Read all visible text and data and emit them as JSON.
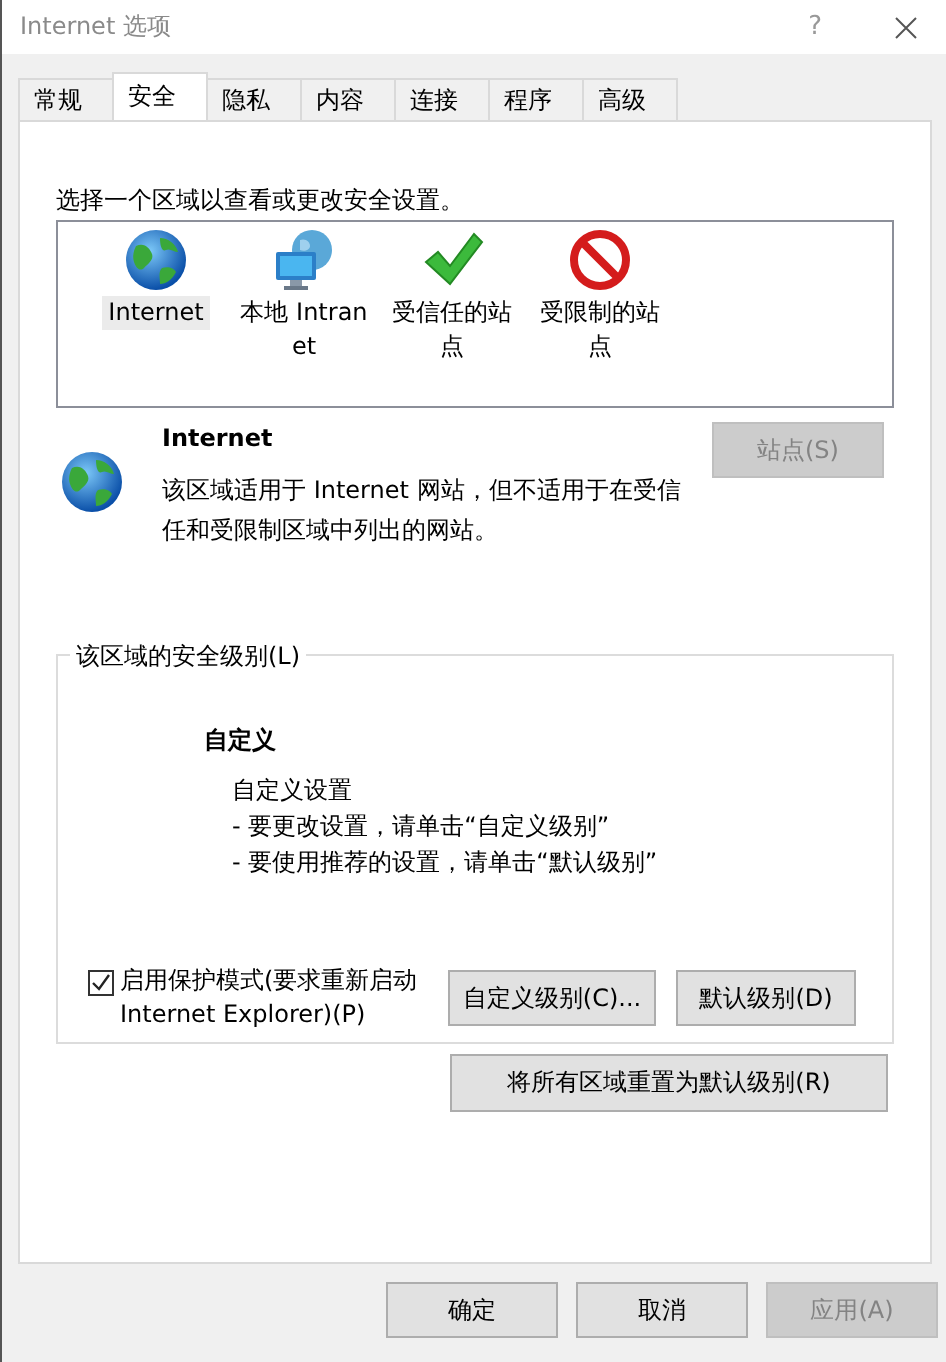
{
  "window": {
    "title": "Internet 选项",
    "help": "?"
  },
  "tabs": [
    {
      "label": "常规",
      "selected": false
    },
    {
      "label": "安全",
      "selected": true
    },
    {
      "label": "隐私",
      "selected": false
    },
    {
      "label": "内容",
      "selected": false
    },
    {
      "label": "连接",
      "selected": false
    },
    {
      "label": "程序",
      "selected": false
    },
    {
      "label": "高级",
      "selected": false
    }
  ],
  "zone_prompt": "选择一个区域以查看或更改安全设置。",
  "zones": [
    {
      "kind": "globe",
      "label": "Internet",
      "selected": true
    },
    {
      "kind": "intranet",
      "label": "本地 Intranet",
      "selected": false
    },
    {
      "kind": "trusted",
      "label": "受信任的站点",
      "selected": false
    },
    {
      "kind": "restricted",
      "label": "受限制的站点",
      "selected": false
    }
  ],
  "zone_info": {
    "kind": "globe",
    "title": "Internet",
    "text": "该区域适用于 Internet 网站，但不适用于在受信任和受限制区域中列出的网站。",
    "sites_button": {
      "label": "站点(S)",
      "disabled": true
    }
  },
  "security_level": {
    "legend": "该区域的安全级别(L)",
    "level_name": "自定义",
    "lines": [
      "自定义设置",
      "- 要更改设置，请单击“自定义级别”",
      "- 要使用推荐的设置，请单击“默认级别”"
    ],
    "protected_mode": {
      "label": "启用保护模式(要求重新启动 Internet Explorer)(P)",
      "checked": true
    },
    "buttons": [
      {
        "label": "自定义级别(C)...",
        "disabled": false
      },
      {
        "label": "默认级别(D)",
        "disabled": false
      }
    ]
  },
  "reset_button": {
    "label": "将所有区域重置为默认级别(R)",
    "disabled": false
  },
  "footer_buttons": [
    {
      "label": "确定",
      "disabled": false
    },
    {
      "label": "取消",
      "disabled": false
    },
    {
      "label": "应用(A)",
      "disabled": true
    }
  ]
}
